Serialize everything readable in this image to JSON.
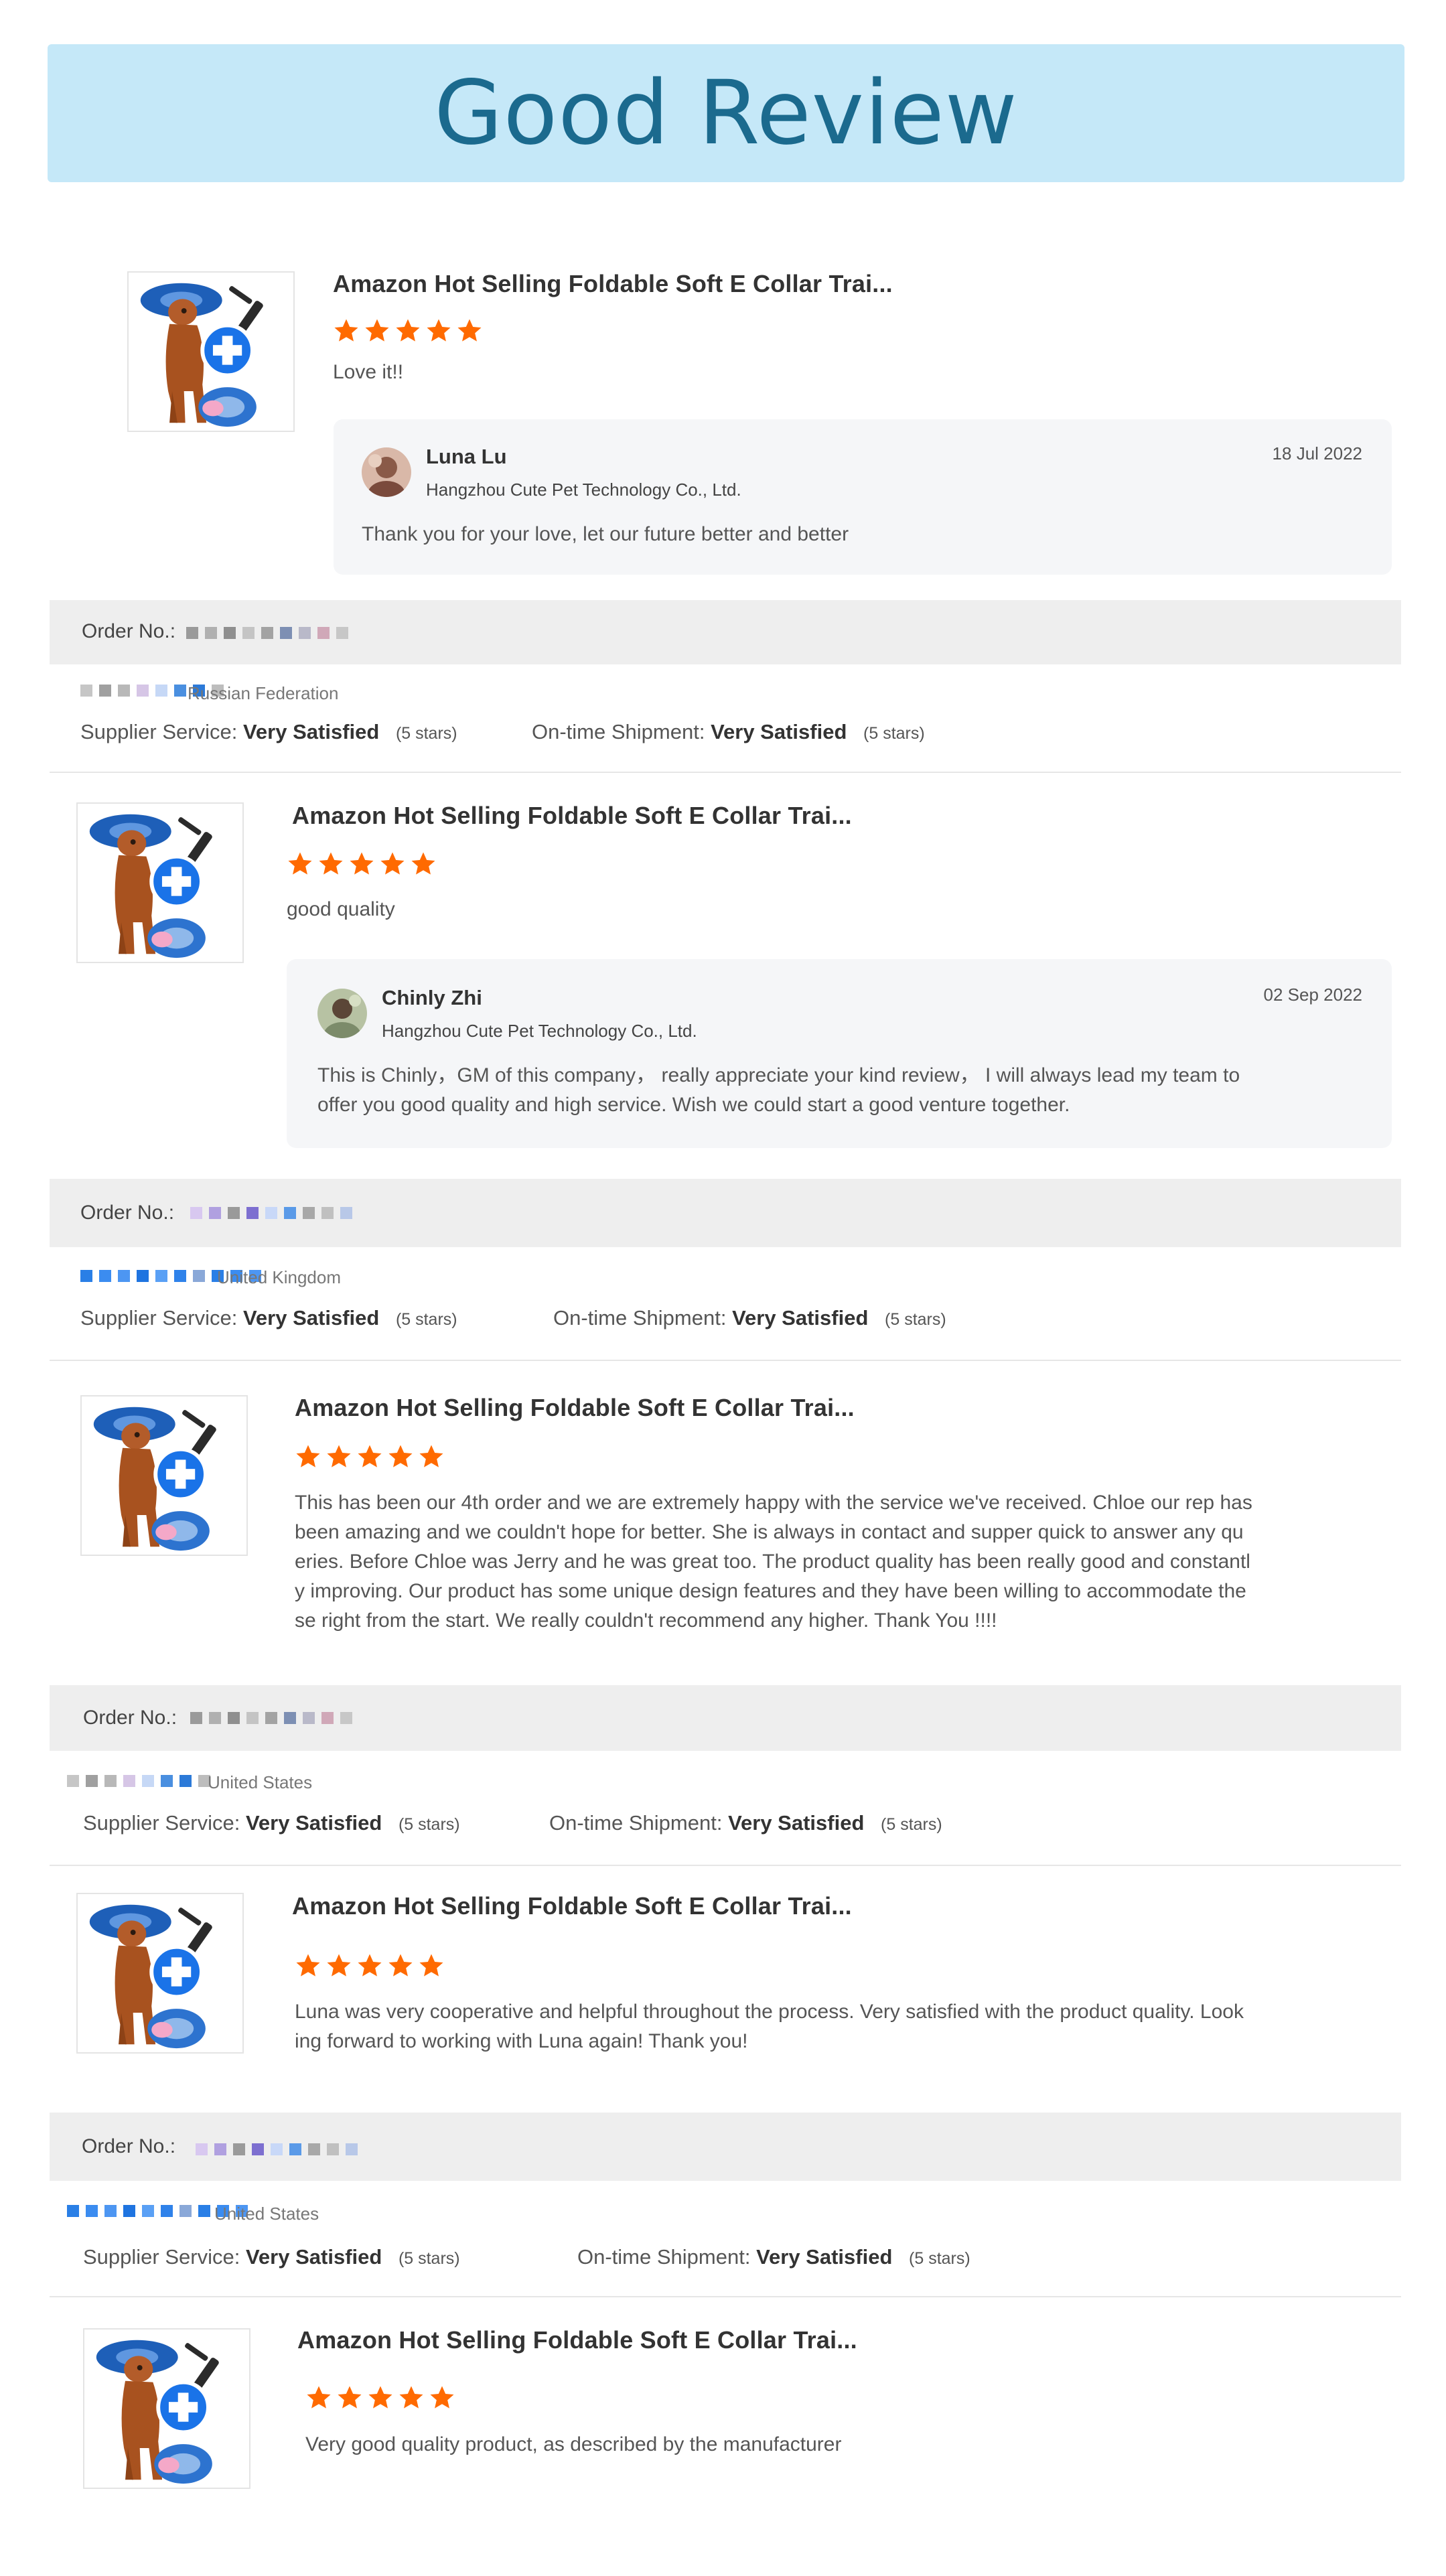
{
  "banner": {
    "title": "Good Review"
  },
  "colors": {
    "banner_bg": "#c5e8f8",
    "banner_text": "#1b6a8e",
    "star": "#ff6a00",
    "order_bar": "#eeeeee"
  },
  "product_title": "Amazon Hot Selling Foldable Soft E Collar Trai...",
  "rating": {
    "stars": 5,
    "max": 5
  },
  "reviews": [
    {
      "text": "Love it!!",
      "reply": {
        "name": "Luna Lu",
        "company": "Hangzhou Cute Pet Technology Co., Ltd.",
        "date": "18 Jul 2022",
        "message": "Thank you for your love, let our future better and better"
      }
    },
    {
      "text": "good quality",
      "reply": {
        "name": "Chinly Zhi",
        "company": "Hangzhou Cute Pet Technology Co., Ltd.",
        "date": "02 Sep 2022",
        "message_lines": [
          "This is Chinly，GM of this company，  really appreciate your kind review，  I will always lead my team to",
          "offer you good quality and high service. Wish we could start a good venture together."
        ]
      }
    },
    {
      "text_lines": [
        "This has been our 4th order and we are extremely happy with the service we've received. Chloe our rep has",
        "been amazing and we couldn't hope for better. She is always in contact and supper quick to answer any qu",
        "eries. Before Chloe was Jerry and he was great too. The product quality has been really good and constantl",
        "y improving. Our product has some unique design features and they have been willing to accommodate the",
        "se right from the start. We really couldn't recommend any higher. Thank You !!!!"
      ]
    },
    {
      "text_lines": [
        "Luna was very cooperative and helpful throughout the process. Very satisfied with the product quality. Look",
        "ing forward to working with Luna again! Thank you!"
      ]
    },
    {
      "text": "Very good quality product, as described by the manufacturer"
    }
  ],
  "orders": [
    {
      "label": "Order No.:",
      "country": "Russian Federation"
    },
    {
      "label": "Order No.:",
      "country": "United Kingdom"
    },
    {
      "label": "Order No.:",
      "country": "United States"
    },
    {
      "label": "Order No.:",
      "country": "United States"
    }
  ],
  "service": {
    "supplier_label": "Supplier Service:",
    "shipment_label": "On-time Shipment:",
    "value": "Very Satisfied",
    "stars_note": "(5 stars)"
  }
}
